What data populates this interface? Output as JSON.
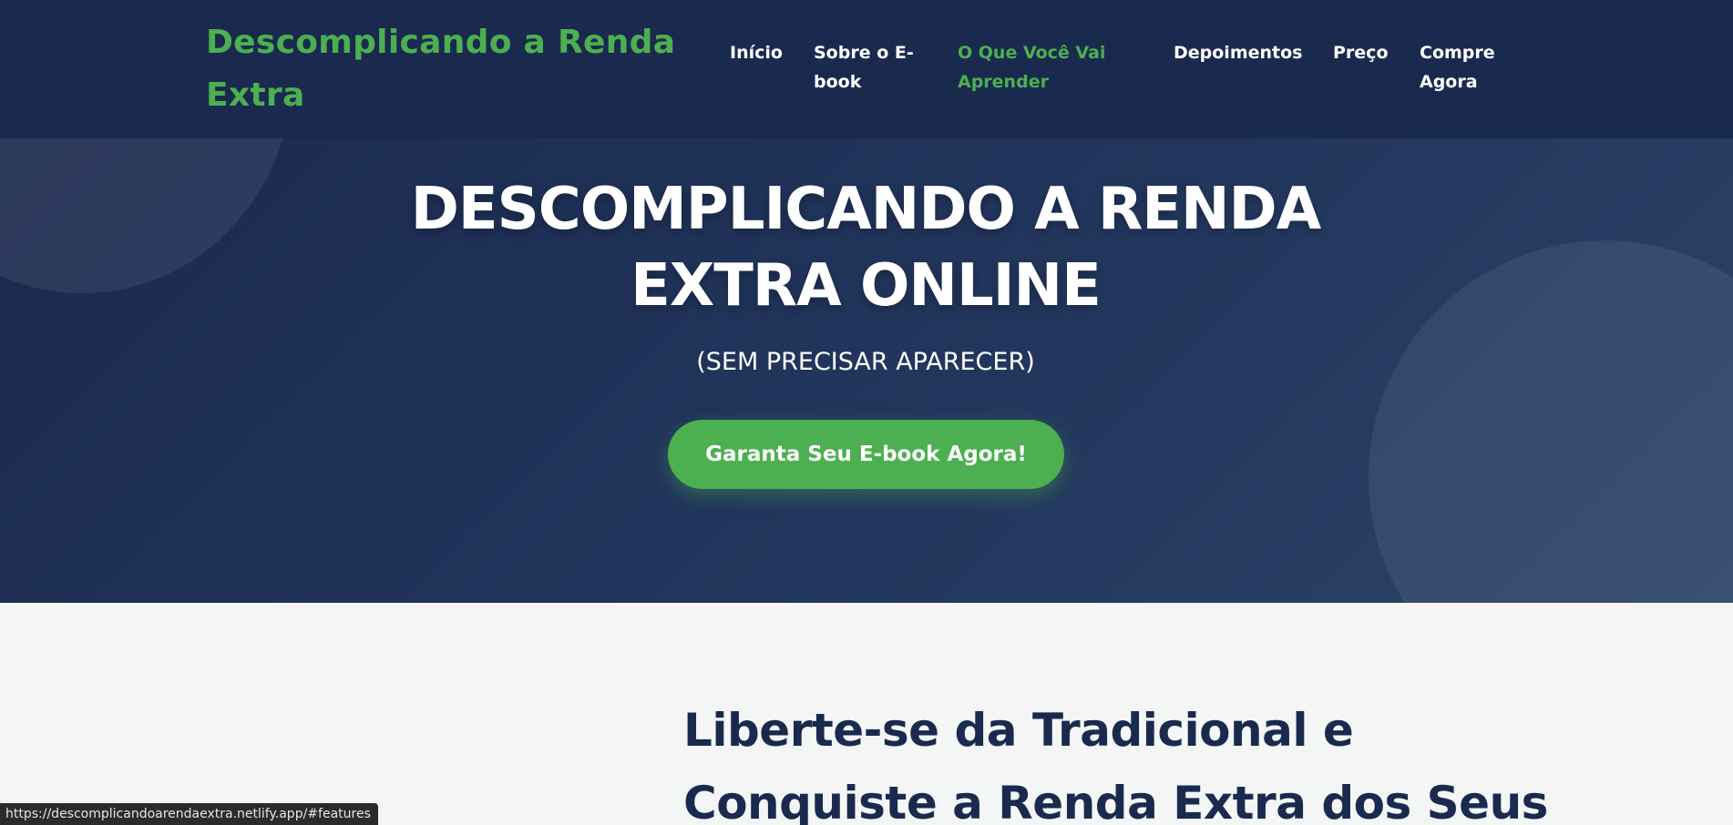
{
  "header": {
    "logo": "Descomplicando a Renda Extra",
    "nav": [
      {
        "label": "Início",
        "active": false
      },
      {
        "label": "Sobre o E-book",
        "active": false
      },
      {
        "label": "O Que Você Vai Aprender",
        "active": true
      },
      {
        "label": "Depoimentos",
        "active": false
      },
      {
        "label": "Preço",
        "active": false
      },
      {
        "label": "Compre Agora",
        "active": false
      }
    ]
  },
  "hero": {
    "title": "DESCOMPLICANDO A RENDA EXTRA ONLINE",
    "subtitle": "(SEM PRECISAR APARECER)",
    "cta_label": "Garanta Seu E-book Agora!"
  },
  "features": {
    "heading": "Liberte-se da Tradicional e Conquiste a Renda Extra dos Seus"
  },
  "status_bar": {
    "url": "https://descomplicandoarendaextra.netlify.app/#features"
  },
  "colors": {
    "header_bg": "#1a2a4f",
    "accent": "#4caf50",
    "heading_text": "#1a2a4f",
    "section_bg": "#f4f6f5"
  }
}
